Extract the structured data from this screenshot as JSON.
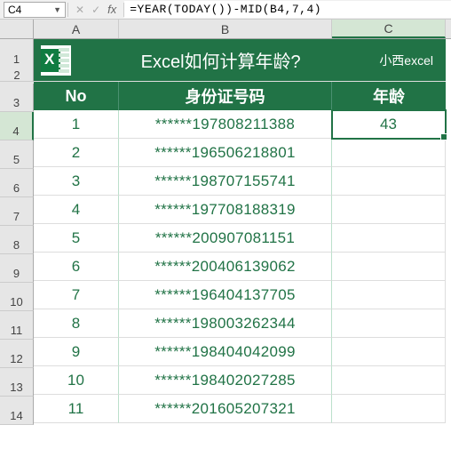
{
  "name_box": "C4",
  "formula": "=YEAR(TODAY())-MID(B4,7,4)",
  "columns": [
    "A",
    "B",
    "C"
  ],
  "selected_column": "C",
  "selected_row": 4,
  "row_numbers": [
    1,
    2,
    3,
    4,
    5,
    6,
    7,
    8,
    9,
    10,
    11,
    12,
    13,
    14
  ],
  "banner": {
    "title": "Excel如何计算年龄?",
    "author": "小西excel",
    "logo_letter": "X"
  },
  "headers": {
    "no": "No",
    "id": "身份证号码",
    "age": "年龄"
  },
  "rows": [
    {
      "no": "1",
      "id": "******197808211388",
      "age": "43"
    },
    {
      "no": "2",
      "id": "******196506218801",
      "age": ""
    },
    {
      "no": "3",
      "id": "******198707155741",
      "age": ""
    },
    {
      "no": "4",
      "id": "******197708188319",
      "age": ""
    },
    {
      "no": "5",
      "id": "******200907081151",
      "age": ""
    },
    {
      "no": "6",
      "id": "******200406139062",
      "age": ""
    },
    {
      "no": "7",
      "id": "******196404137705",
      "age": ""
    },
    {
      "no": "8",
      "id": "******198003262344",
      "age": ""
    },
    {
      "no": "9",
      "id": "******198404042099",
      "age": ""
    },
    {
      "no": "10",
      "id": "******198402027285",
      "age": ""
    },
    {
      "no": "11",
      "id": "******201605207321",
      "age": ""
    }
  ],
  "icons": {
    "cancel": "✕",
    "confirm": "✓",
    "fx": "fx",
    "dropdown": "▼"
  }
}
